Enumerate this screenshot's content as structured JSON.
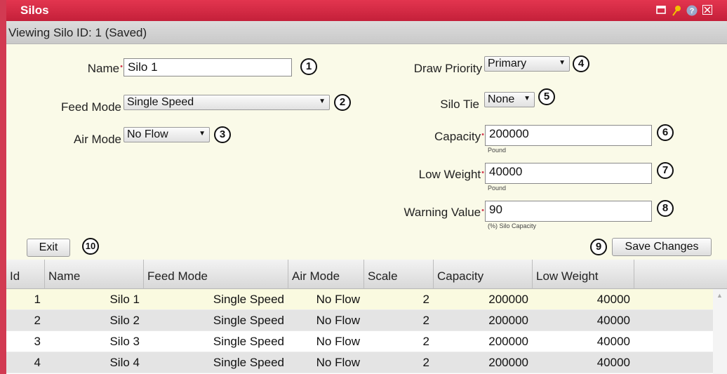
{
  "window": {
    "title": "Silos"
  },
  "titlebar_icons": [
    "window-icon",
    "pin-icon",
    "help-icon",
    "close-icon"
  ],
  "status": "Viewing Silo ID: 1 (Saved)",
  "form": {
    "name_label": "Name",
    "name_value": "Silo 1",
    "feed_mode_label": "Feed Mode",
    "feed_mode_value": "Single Speed",
    "air_mode_label": "Air Mode",
    "air_mode_value": "No Flow",
    "draw_priority_label": "Draw Priority",
    "draw_priority_value": "Primary",
    "silo_tie_label": "Silo Tie",
    "silo_tie_value": "None",
    "capacity_label": "Capacity",
    "capacity_value": "200000",
    "capacity_unit": "Pound",
    "low_weight_label": "Low Weight",
    "low_weight_value": "40000",
    "low_weight_unit": "Pound",
    "warning_label": "Warning Value",
    "warning_value": "90",
    "warning_unit": "(%) Silo Capacity"
  },
  "badges": [
    "1",
    "2",
    "3",
    "4",
    "5",
    "6",
    "7",
    "8",
    "9",
    "10"
  ],
  "buttons": {
    "exit": "Exit",
    "save": "Save Changes"
  },
  "table": {
    "columns": [
      "Id",
      "Name",
      "Feed Mode",
      "Air Mode",
      "Scale",
      "Capacity",
      "Low Weight"
    ],
    "rows": [
      [
        "1",
        "Silo 1",
        "Single Speed",
        "No Flow",
        "2",
        "200000",
        "40000"
      ],
      [
        "2",
        "Silo 2",
        "Single Speed",
        "No Flow",
        "2",
        "200000",
        "40000"
      ],
      [
        "3",
        "Silo 3",
        "Single Speed",
        "No Flow",
        "2",
        "200000",
        "40000"
      ],
      [
        "4",
        "Silo 4",
        "Single Speed",
        "No Flow",
        "2",
        "200000",
        "40000"
      ]
    ],
    "selected_row_color": "#fafae0",
    "alt_row_color": "#e4e4e4"
  },
  "colors": {
    "accent": "#d23a52",
    "form_bg": "#fafae8"
  }
}
